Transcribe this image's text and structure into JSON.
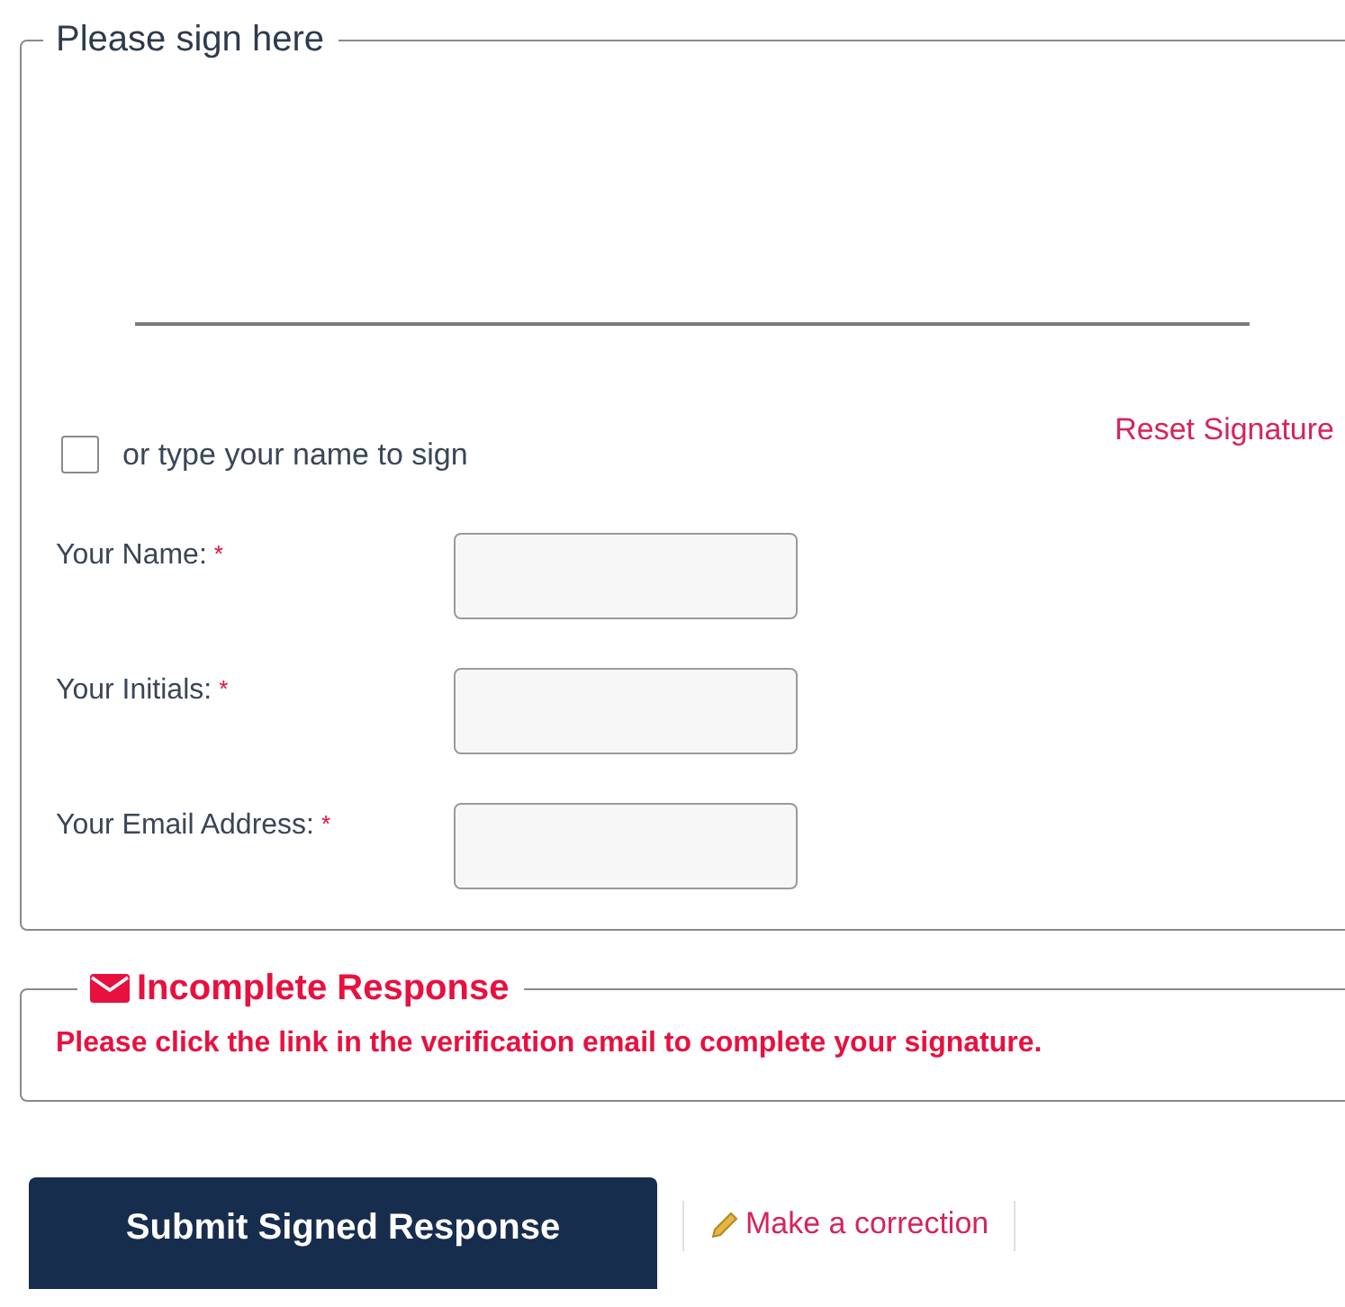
{
  "signature_panel": {
    "legend": "Please sign here",
    "reset_link": "Reset Signature",
    "type_to_sign": {
      "label": "or type your name to sign",
      "checked": false
    },
    "fields": [
      {
        "label": "Your Name:",
        "required_mark": "*"
      },
      {
        "label": "Your Initials:",
        "required_mark": "*"
      },
      {
        "label": "Your Email Address:",
        "required_mark": "*"
      }
    ]
  },
  "notice": {
    "title": "Incomplete Response",
    "message": "Please click the link in the verification email to complete your signature."
  },
  "actions": {
    "submit": "Submit Signed Response",
    "correction_link": "Make a correction"
  }
}
